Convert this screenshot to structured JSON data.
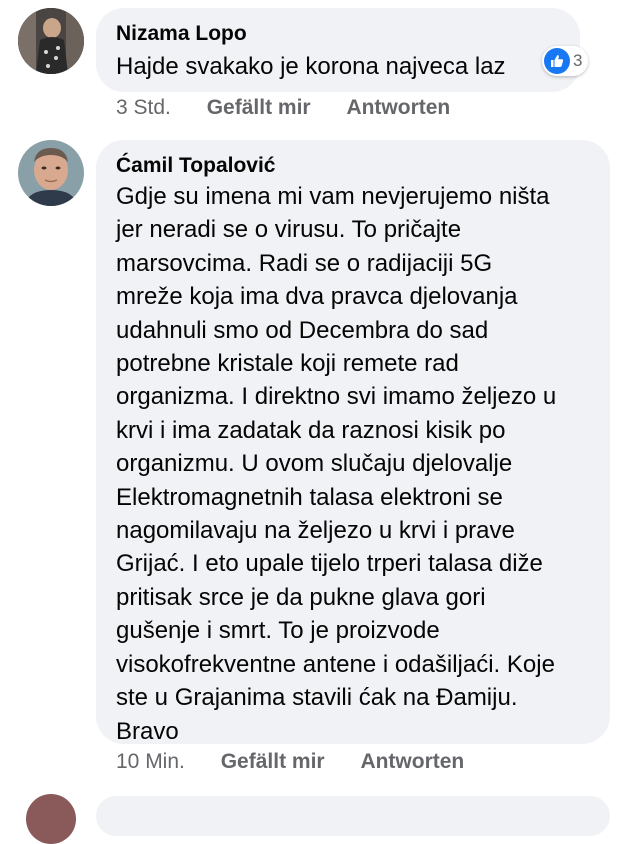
{
  "colors": {
    "bubble": "#f0f2f5",
    "meta": "#65676b",
    "like": "#1877f2"
  },
  "comments": [
    {
      "author": "Nizama Lopo",
      "lines": [
        "Hajde svakako je korona najveca laz"
      ],
      "time": "3 Std.",
      "like_label": "Gefällt mir",
      "reply_label": "Antworten",
      "reaction_icon": "like-icon",
      "reaction_count": "3"
    },
    {
      "author": "Ćamil Topalović",
      "lines": [
        "Gdje su imena mi vam nevjerujemo ništa",
        "jer neradi se o virusu. To pričajte",
        "marsovcima. Radi se o radijaciji 5G",
        "mreže koja ima dva pravca djelovanja",
        "udahnuli smo od Decembra do sad",
        "potrebne kristale koji remete rad",
        "organizma. I direktno svi imamo željezo u",
        "krvi i ima zadatak da raznosi kisik po",
        "organizmu. U ovom slučaju djelovalje",
        "Elektromagnetnih talasa elektroni se",
        "nagomilavaju na željezo u krvi i prave",
        "Grijać. I eto upale tijelo trperi talasa diže",
        "pritisak srce je da pukne glava gori",
        "gušenje i smrt. To je proizvode",
        "visokofrekventne antene i odašiljaći. Koje",
        "ste u Grajanima stavili ćak na Đamiju.",
        "Bravo"
      ],
      "time": "10 Min.",
      "like_label": "Gefällt mir",
      "reply_label": "Antworten"
    }
  ]
}
